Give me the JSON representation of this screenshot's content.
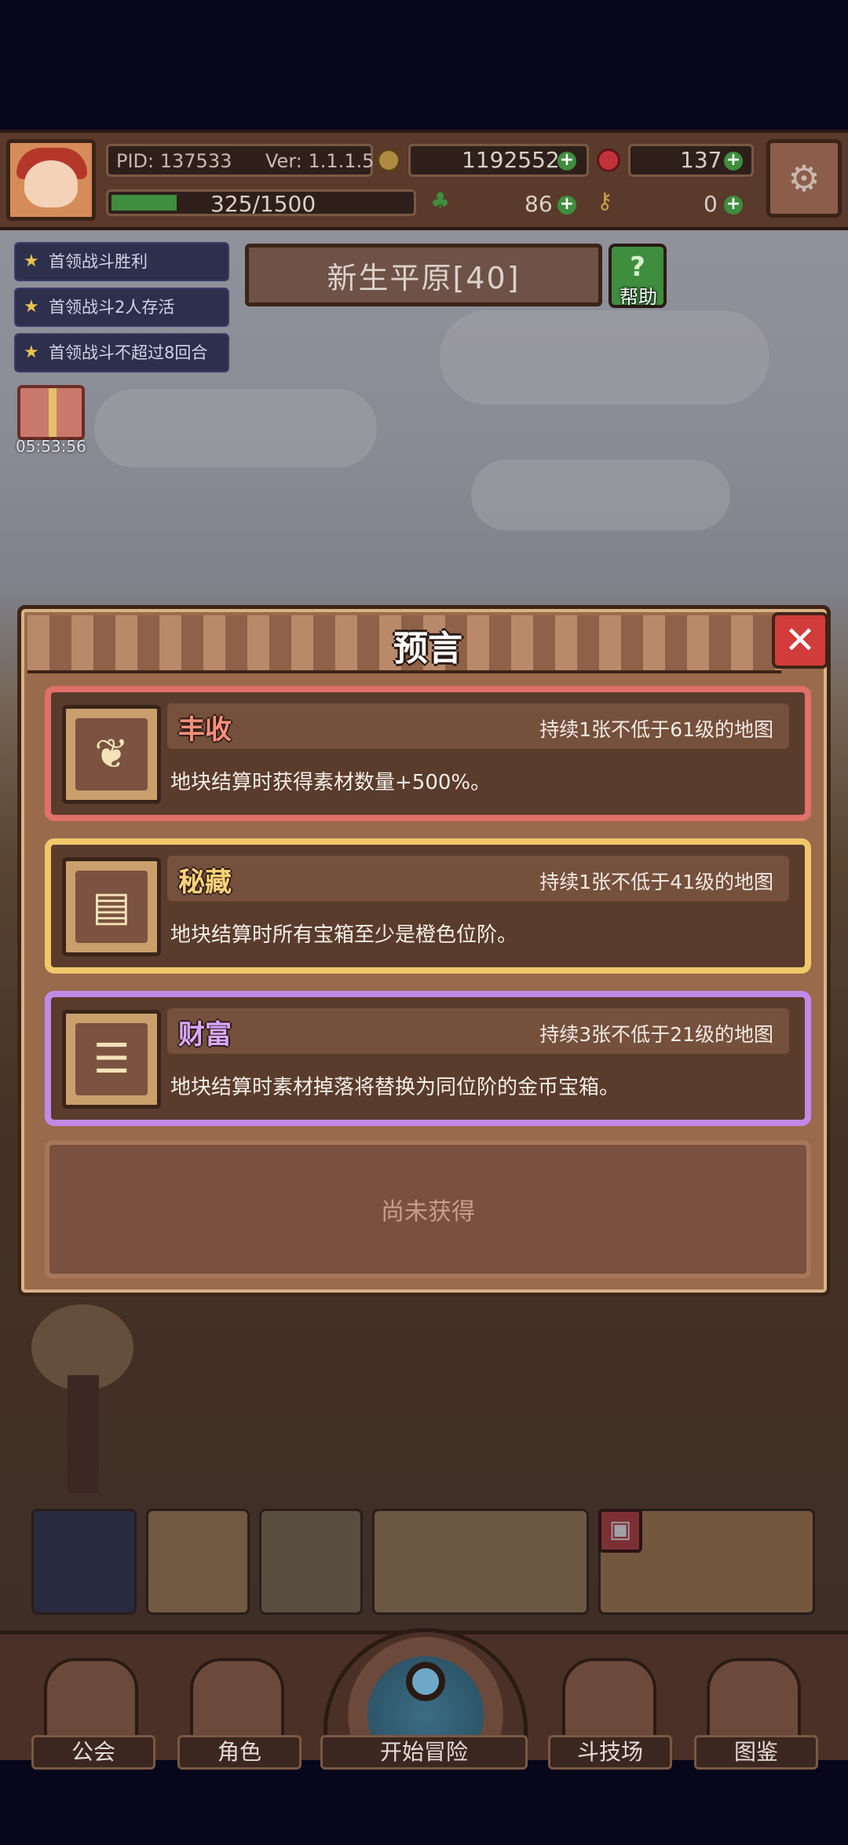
{
  "top_bar": {
    "pid": "PID: 137533",
    "version": "Ver: 1.1.1.5",
    "gold": "1192552",
    "gems": "137",
    "exp": "325/1500",
    "exp_fraction": 0.2167,
    "clover": "86",
    "keys": "0"
  },
  "quests": [
    "首领战斗胜利",
    "首领战斗2人存活",
    "首领战斗不超过8回合"
  ],
  "gift_timer": "05:53:56",
  "map_banner": "新生平原[40]",
  "help_label": "帮助",
  "modal": {
    "title": "预言",
    "cards": [
      {
        "name": "丰收",
        "condition": "持续1张不低于61级的地图",
        "desc": "地块结算时获得素材数量+500%。",
        "accent": "#e0706a",
        "name_color": "#ff8f7e",
        "icon": "harvest-icon"
      },
      {
        "name": "秘藏",
        "condition": "持续1张不低于41级的地图",
        "desc": "地块结算时所有宝箱至少是橙色位阶。",
        "accent": "#f1c76a",
        "name_color": "#ffd27a",
        "icon": "scroll-icon"
      },
      {
        "name": "财富",
        "condition": "持续3张不低于21级的地图",
        "desc": "地块结算时素材掉落将替换为同位阶的金币宝箱。",
        "accent": "#c28ae8",
        "name_color": "#d9a6ff",
        "icon": "coin-stack-icon"
      }
    ],
    "empty_slot": "尚未获得"
  },
  "nav": {
    "guild": "公会",
    "character": "角色",
    "start": "开始冒险",
    "arena": "斗技场",
    "codex": "图鉴"
  }
}
